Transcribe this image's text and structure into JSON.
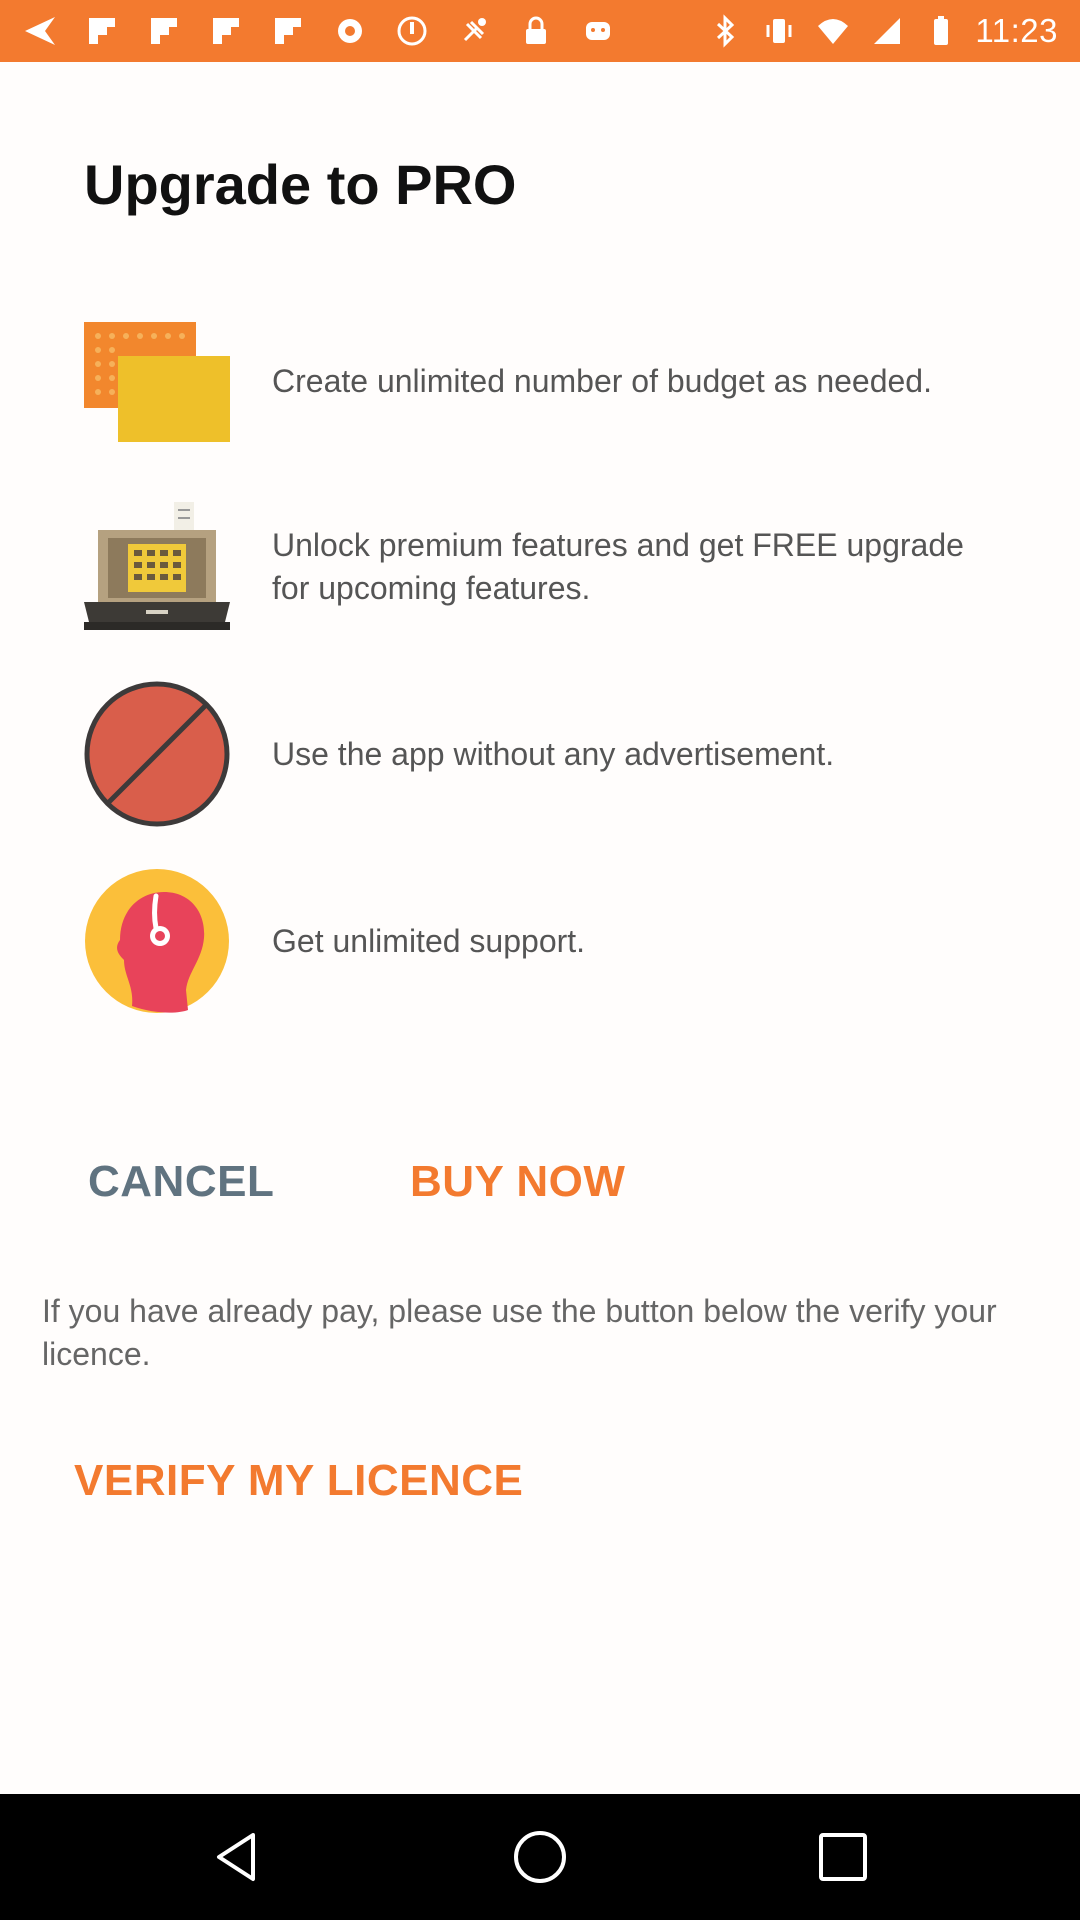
{
  "status_bar": {
    "time": "11:23",
    "left_icons": [
      "navigation-arrow-icon",
      "flipboard-icon",
      "flipboard-icon",
      "flipboard-icon",
      "flipboard-icon",
      "record-icon",
      "disc-icon",
      "fake-gps-icon",
      "lock-icon",
      "android-icon"
    ],
    "right_icons": [
      "bluetooth-icon",
      "vibrate-icon",
      "wifi-icon",
      "signal-icon",
      "battery-icon"
    ],
    "background_color": "#f37a2f"
  },
  "page": {
    "title": "Upgrade to PRO"
  },
  "features": [
    {
      "icon": "budget-folders-icon",
      "text": "Create unlimited number of budget as needed."
    },
    {
      "icon": "cash-register-icon",
      "text": "Unlock premium features and get FREE upgrade for upcoming features."
    },
    {
      "icon": "no-ads-icon",
      "text": "Use the app without any advertisement."
    },
    {
      "icon": "support-headset-icon",
      "text": "Get unlimited support."
    }
  ],
  "actions": {
    "cancel_label": "CANCEL",
    "buy_label": "BUY NOW",
    "note": "If you have already pay, please use the button below the verify your licence.",
    "verify_label": "VERIFY MY LICENCE"
  },
  "colors": {
    "accent": "#f37a2f",
    "cancel": "#607380",
    "title": "#111111",
    "body_text": "#555555"
  },
  "nav_bar": {
    "icons": [
      "back-icon",
      "home-icon",
      "recent-apps-icon"
    ]
  }
}
